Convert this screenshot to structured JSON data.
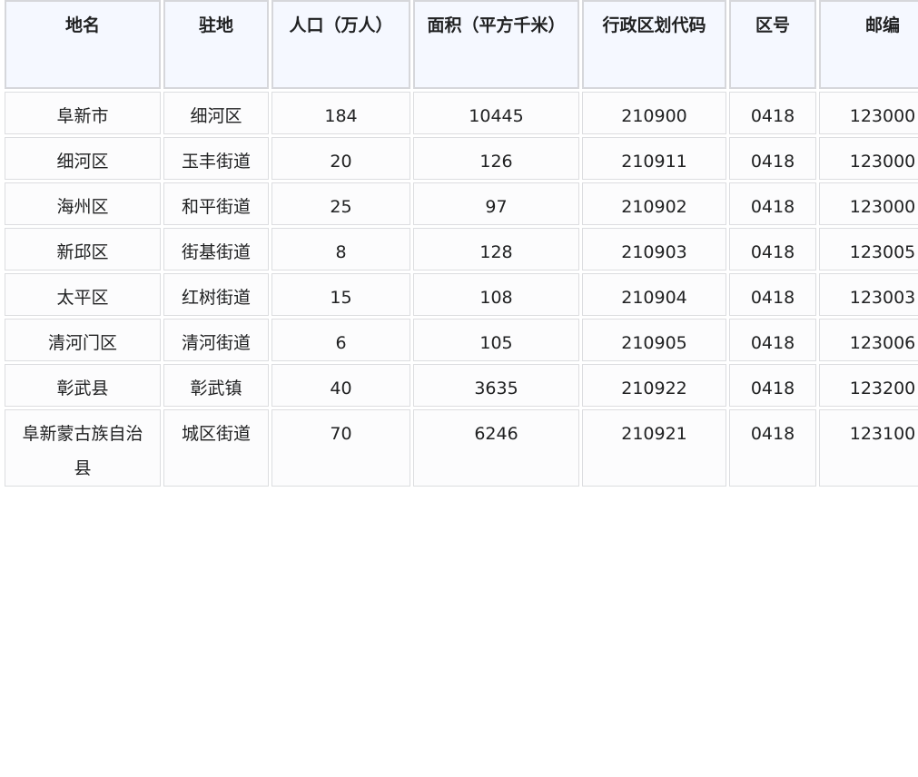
{
  "table": {
    "headers": [
      "地名",
      "驻地",
      "人口（万人）",
      "面积（平方千米）",
      "行政区划代码",
      "区号",
      "邮编"
    ],
    "rows": [
      [
        "阜新市",
        "细河区",
        "184",
        "10445",
        "210900",
        "0418",
        "123000"
      ],
      [
        "细河区",
        "玉丰街道",
        "20",
        "126",
        "210911",
        "0418",
        "123000"
      ],
      [
        "海州区",
        "和平街道",
        "25",
        "97",
        "210902",
        "0418",
        "123000"
      ],
      [
        "新邱区",
        "街基街道",
        "8",
        "128",
        "210903",
        "0418",
        "123005"
      ],
      [
        "太平区",
        "红树街道",
        "15",
        "108",
        "210904",
        "0418",
        "123003"
      ],
      [
        "清河门区",
        "清河街道",
        "6",
        "105",
        "210905",
        "0418",
        "123006"
      ],
      [
        "彰武县",
        "彰武镇",
        "40",
        "3635",
        "210922",
        "0418",
        "123200"
      ],
      [
        "阜新蒙古族自治县",
        "城区街道",
        "70",
        "6246",
        "210921",
        "0418",
        "123100"
      ]
    ]
  }
}
